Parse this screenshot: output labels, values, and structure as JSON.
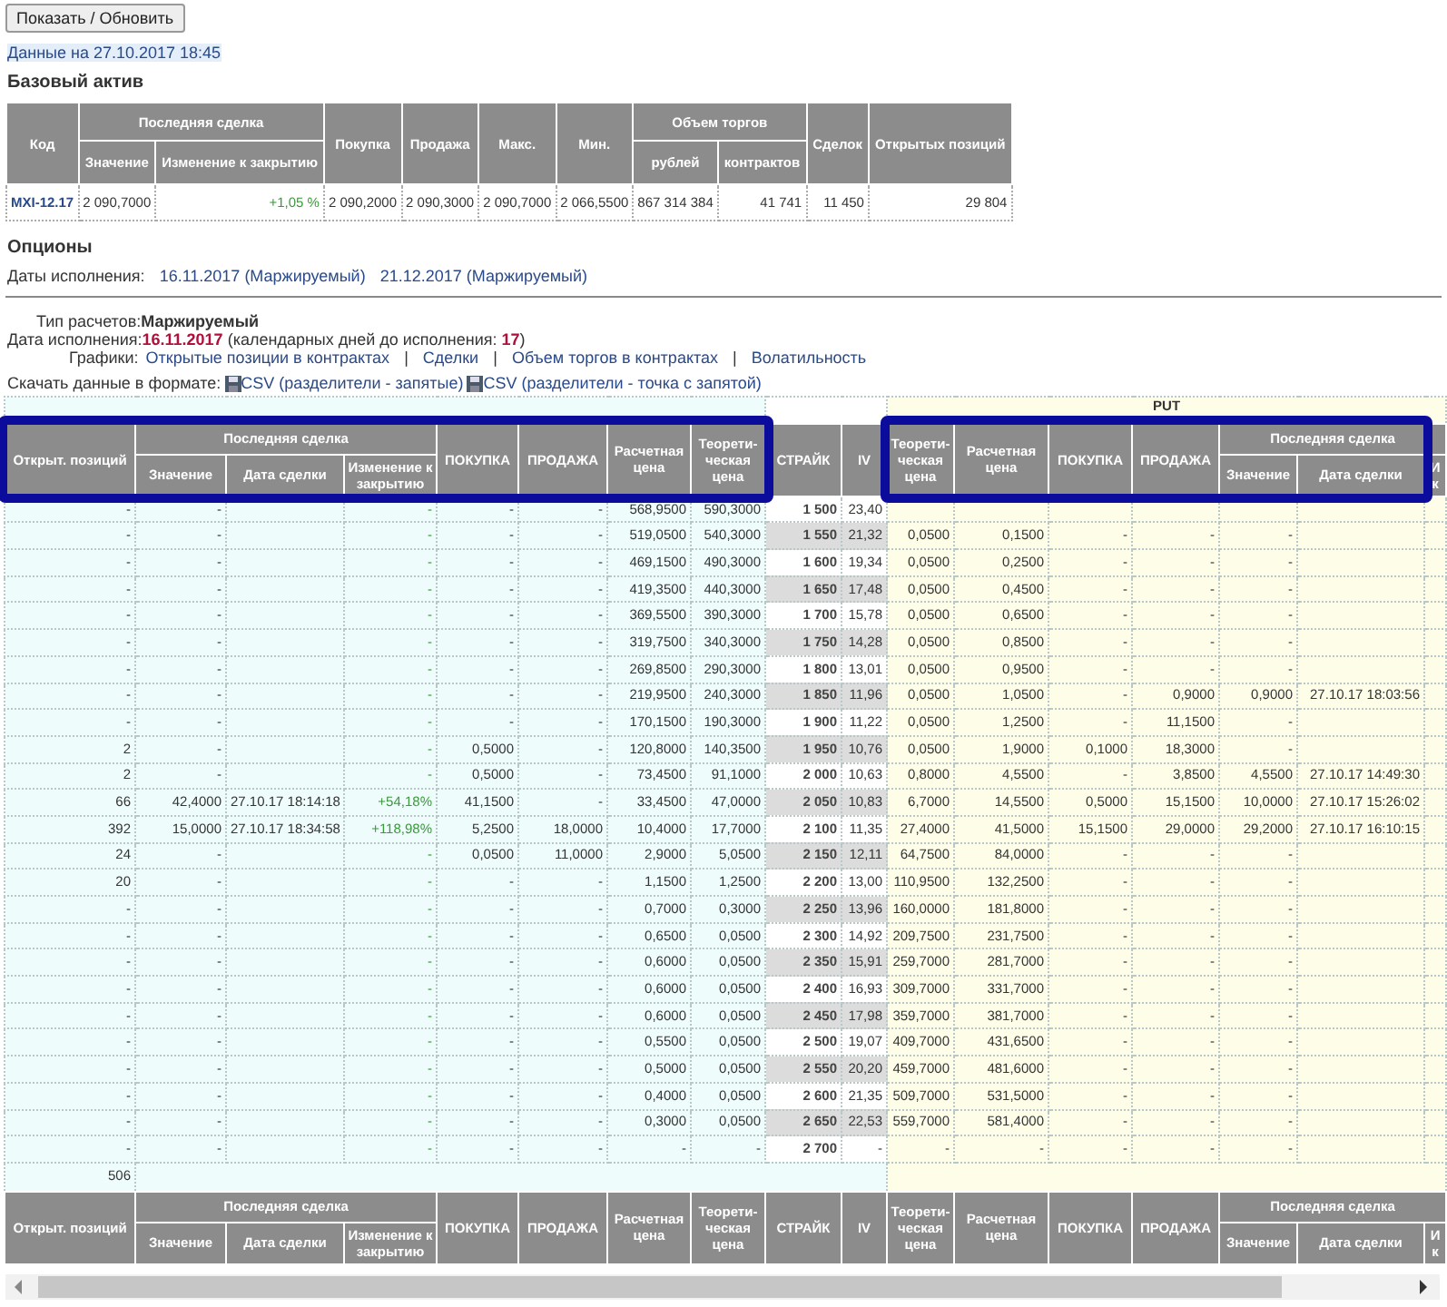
{
  "refresh_button": "Показать / Обновить",
  "data_time": "Данные на 27.10.2017 18:45",
  "underlying": {
    "title": "Базовый актив",
    "header": [
      {
        "label": "Код"
      },
      {
        "group": "Последняя сделка",
        "columns": [
          "Значение",
          "Изменение к закрытию"
        ]
      },
      {
        "label": "Покупка"
      },
      {
        "label": "Продажа"
      },
      {
        "label": "Макс."
      },
      {
        "label": "Мин."
      },
      {
        "group": "Объем торгов",
        "columns": [
          "рублей",
          "контрактов"
        ]
      },
      {
        "label": "Сделок"
      },
      {
        "label": "Открытых позиций"
      }
    ],
    "row": {
      "code": "MXI-12.17",
      "cells": [
        "2 090,7000",
        "+1,05 %",
        "2 090,2000",
        "2 090,3000",
        "2 090,7000",
        "2 066,5500",
        "867 314 384",
        "41 741",
        "11 450",
        "29 804"
      ]
    }
  },
  "options": {
    "title": "Опционы",
    "dates_label": "Даты исполнения:",
    "dates": [
      "16.11.2017 (Маржируемый)",
      "21.12.2017 (Маржируемый)"
    ]
  },
  "settlement": "Тип расчетов:**Маржируемый**",
  "expiry": {
    "label": "Дата исполнения:",
    "date": "16.11.2017",
    "note": "(календарных дней до исполнения:",
    "days": "17",
    "close": ")"
  },
  "charts": {
    "label": "Графики:",
    "links": [
      "Открытые позиции в контрактах",
      "Сделки",
      "Объем торгов в контрактах",
      "Волатильность"
    ],
    "separator": "|"
  },
  "download": {
    "label": "Скачать данные в формате:",
    "links": [
      "CSV (разделители - запятые)",
      "CSV (разделители - точка с запятой)"
    ]
  },
  "put_label": "PUT",
  "header": {
    "highlighted_sides": {
      "call": true,
      "put": true
    },
    "call": [
      {
        "label": "Открыт. позиций"
      },
      {
        "group": "Последняя сделка",
        "columns": [
          "Значение",
          "Дата сделки",
          "Изменение к закрытию"
        ]
      },
      {
        "label": "ПОКУПКА"
      },
      {
        "label": "ПРОДАЖА"
      },
      {
        "label": "Расчетная цена"
      },
      {
        "label": "Теорети-ческая цена"
      }
    ],
    "middle": [
      {
        "label": "СТРАЙК"
      },
      {
        "label": "IV"
      }
    ],
    "put": [
      {
        "label": "Теорети-ческая цена"
      },
      {
        "label": "Расчетная цена"
      },
      {
        "label": "ПОКУПКА"
      },
      {
        "label": "ПРОДАЖА"
      },
      {
        "group": "Последняя сделка",
        "columns": [
          "Значение",
          "Дата сделки",
          "И к"
        ]
      }
    ]
  },
  "rows": [
    {
      "call": {
        "oi": "-",
        "value": "-",
        "change": "-",
        "buy": "-",
        "sell": "-",
        "calc": "568,9500",
        "theor": "590,3000"
      },
      "strike": "1 500",
      "iv": "23,40"
    },
    {
      "call": {
        "oi": "-",
        "value": "-",
        "change": "-",
        "buy": "-",
        "sell": "-",
        "calc": "519,0500",
        "theor": "540,3000"
      },
      "strike": "1 550",
      "iv": "21,32",
      "put": {
        "theor": "0,0500",
        "calc": "0,1500",
        "buy": "-",
        "sell": "-",
        "value": "-"
      }
    },
    {
      "call": {
        "oi": "-",
        "value": "-",
        "change": "-",
        "buy": "-",
        "sell": "-",
        "calc": "469,1500",
        "theor": "490,3000"
      },
      "strike": "1 600",
      "iv": "19,34",
      "put": {
        "theor": "0,0500",
        "calc": "0,2500",
        "buy": "-",
        "sell": "-",
        "value": "-"
      }
    },
    {
      "call": {
        "oi": "-",
        "value": "-",
        "change": "-",
        "buy": "-",
        "sell": "-",
        "calc": "419,3500",
        "theor": "440,3000"
      },
      "strike": "1 650",
      "iv": "17,48",
      "put": {
        "theor": "0,0500",
        "calc": "0,4500",
        "buy": "-",
        "sell": "-",
        "value": "-"
      }
    },
    {
      "call": {
        "oi": "-",
        "value": "-",
        "change": "-",
        "buy": "-",
        "sell": "-",
        "calc": "369,5500",
        "theor": "390,3000"
      },
      "strike": "1 700",
      "iv": "15,78",
      "put": {
        "theor": "0,0500",
        "calc": "0,6500",
        "buy": "-",
        "sell": "-",
        "value": "-"
      }
    },
    {
      "call": {
        "oi": "-",
        "value": "-",
        "change": "-",
        "buy": "-",
        "sell": "-",
        "calc": "319,7500",
        "theor": "340,3000"
      },
      "strike": "1 750",
      "iv": "14,28",
      "put": {
        "theor": "0,0500",
        "calc": "0,8500",
        "buy": "-",
        "sell": "-",
        "value": "-"
      }
    },
    {
      "call": {
        "oi": "-",
        "value": "-",
        "change": "-",
        "buy": "-",
        "sell": "-",
        "calc": "269,8500",
        "theor": "290,3000"
      },
      "strike": "1 800",
      "iv": "13,01",
      "put": {
        "theor": "0,0500",
        "calc": "0,9500",
        "buy": "-",
        "sell": "-",
        "value": "-"
      }
    },
    {
      "call": {
        "oi": "-",
        "value": "-",
        "change": "-",
        "buy": "-",
        "sell": "-",
        "calc": "219,9500",
        "theor": "240,3000"
      },
      "strike": "1 850",
      "iv": "11,96",
      "put": {
        "theor": "0,0500",
        "calc": "1,0500",
        "buy": "-",
        "sell": "0,9000",
        "value": "0,9000",
        "date": "27.10.17 18:03:56"
      }
    },
    {
      "call": {
        "oi": "-",
        "value": "-",
        "change": "-",
        "buy": "-",
        "sell": "-",
        "calc": "170,1500",
        "theor": "190,3000"
      },
      "strike": "1 900",
      "iv": "11,22",
      "put": {
        "theor": "0,0500",
        "calc": "1,2500",
        "buy": "-",
        "sell": "11,1500",
        "value": "-"
      }
    },
    {
      "call": {
        "oi": "2",
        "value": "-",
        "change": "-",
        "buy": "0,5000",
        "sell": "-",
        "calc": "120,8000",
        "theor": "140,3500"
      },
      "strike": "1 950",
      "iv": "10,76",
      "put": {
        "theor": "0,0500",
        "calc": "1,9000",
        "buy": "0,1000",
        "sell": "18,3000",
        "value": "-"
      }
    },
    {
      "call": {
        "oi": "2",
        "value": "-",
        "change": "-",
        "buy": "0,5000",
        "sell": "-",
        "calc": "73,4500",
        "theor": "91,1000"
      },
      "strike": "2 000",
      "iv": "10,63",
      "put": {
        "theor": "0,8000",
        "calc": "4,5500",
        "buy": "-",
        "sell": "3,8500",
        "value": "4,5500",
        "date": "27.10.17 14:49:30"
      }
    },
    {
      "call": {
        "oi": "66",
        "value": "42,4000",
        "date": "27.10.17 18:14:18",
        "change": "+54,18%",
        "buy": "41,1500",
        "sell": "-",
        "calc": "33,4500",
        "theor": "47,0000"
      },
      "strike": "2 050",
      "iv": "10,83",
      "put": {
        "theor": "6,7000",
        "calc": "14,5500",
        "buy": "0,5000",
        "sell": "15,1500",
        "value": "10,0000",
        "date": "27.10.17 15:26:02"
      }
    },
    {
      "call": {
        "oi": "392",
        "value": "15,0000",
        "date": "27.10.17 18:34:58",
        "change": "+118,98%",
        "buy": "5,2500",
        "sell": "18,0000",
        "calc": "10,4000",
        "theor": "17,7000"
      },
      "strike": "2 100",
      "iv": "11,35",
      "put": {
        "theor": "27,4000",
        "calc": "41,5000",
        "buy": "15,1500",
        "sell": "29,0000",
        "value": "29,2000",
        "date": "27.10.17 16:10:15"
      }
    },
    {
      "call": {
        "oi": "24",
        "value": "-",
        "change": "-",
        "buy": "0,0500",
        "sell": "11,0000",
        "calc": "2,9000",
        "theor": "5,0500"
      },
      "strike": "2 150",
      "iv": "12,11",
      "put": {
        "theor": "64,7500",
        "calc": "84,0000",
        "buy": "-",
        "sell": "-",
        "value": "-"
      }
    },
    {
      "call": {
        "oi": "20",
        "value": "-",
        "change": "-",
        "buy": "-",
        "sell": "-",
        "calc": "1,1500",
        "theor": "1,2500"
      },
      "strike": "2 200",
      "iv": "13,00",
      "put": {
        "theor": "110,9500",
        "calc": "132,2500",
        "buy": "-",
        "sell": "-",
        "value": "-"
      }
    },
    {
      "call": {
        "oi": "-",
        "value": "-",
        "change": "-",
        "buy": "-",
        "sell": "-",
        "calc": "0,7000",
        "theor": "0,3000"
      },
      "strike": "2 250",
      "iv": "13,96",
      "put": {
        "theor": "160,0000",
        "calc": "181,8000",
        "buy": "-",
        "sell": "-",
        "value": "-"
      }
    },
    {
      "call": {
        "oi": "-",
        "value": "-",
        "change": "-",
        "buy": "-",
        "sell": "-",
        "calc": "0,6500",
        "theor": "0,0500"
      },
      "strike": "2 300",
      "iv": "14,92",
      "put": {
        "theor": "209,7500",
        "calc": "231,7500",
        "buy": "-",
        "sell": "-",
        "value": "-"
      }
    },
    {
      "call": {
        "oi": "-",
        "value": "-",
        "change": "-",
        "buy": "-",
        "sell": "-",
        "calc": "0,6000",
        "theor": "0,0500"
      },
      "strike": "2 350",
      "iv": "15,91",
      "put": {
        "theor": "259,7000",
        "calc": "281,7000",
        "buy": "-",
        "sell": "-",
        "value": "-"
      }
    },
    {
      "call": {
        "oi": "-",
        "value": "-",
        "change": "-",
        "buy": "-",
        "sell": "-",
        "calc": "0,6000",
        "theor": "0,0500"
      },
      "strike": "2 400",
      "iv": "16,93",
      "put": {
        "theor": "309,7000",
        "calc": "331,7000",
        "buy": "-",
        "sell": "-",
        "value": "-"
      }
    },
    {
      "call": {
        "oi": "-",
        "value": "-",
        "change": "-",
        "buy": "-",
        "sell": "-",
        "calc": "0,6000",
        "theor": "0,0500"
      },
      "strike": "2 450",
      "iv": "17,98",
      "put": {
        "theor": "359,7000",
        "calc": "381,7000",
        "buy": "-",
        "sell": "-",
        "value": "-"
      }
    },
    {
      "call": {
        "oi": "-",
        "value": "-",
        "change": "-",
        "buy": "-",
        "sell": "-",
        "calc": "0,5500",
        "theor": "0,0500"
      },
      "strike": "2 500",
      "iv": "19,07",
      "put": {
        "theor": "409,7000",
        "calc": "431,6500",
        "buy": "-",
        "sell": "-",
        "value": "-"
      }
    },
    {
      "call": {
        "oi": "-",
        "value": "-",
        "change": "-",
        "buy": "-",
        "sell": "-",
        "calc": "0,5000",
        "theor": "0,0500"
      },
      "strike": "2 550",
      "iv": "20,20",
      "put": {
        "theor": "459,7000",
        "calc": "481,6000",
        "buy": "-",
        "sell": "-",
        "value": "-"
      }
    },
    {
      "call": {
        "oi": "-",
        "value": "-",
        "change": "-",
        "buy": "-",
        "sell": "-",
        "calc": "0,4000",
        "theor": "0,0500"
      },
      "strike": "2 600",
      "iv": "21,35",
      "put": {
        "theor": "509,7000",
        "calc": "531,5000",
        "buy": "-",
        "sell": "-",
        "value": "-"
      }
    },
    {
      "call": {
        "oi": "-",
        "value": "-",
        "change": "-",
        "buy": "-",
        "sell": "-",
        "calc": "0,3000",
        "theor": "0,0500"
      },
      "strike": "2 650",
      "iv": "22,53",
      "put": {
        "theor": "559,7000",
        "calc": "581,4000",
        "buy": "-",
        "sell": "-",
        "value": "-"
      }
    },
    {
      "call": {
        "oi": "-",
        "value": "-",
        "change": "-",
        "buy": "-",
        "sell": "-",
        "calc": "-",
        "theor": "-"
      },
      "strike": "2 700",
      "iv": "-",
      "put": {
        "theor": "-",
        "calc": "-",
        "buy": "-",
        "sell": "-",
        "value": "-"
      }
    }
  ],
  "total": {
    "open_positions": "506"
  },
  "footer_header": {
    "call": [
      {
        "label": "Открыт. позиций"
      },
      {
        "group": "Последняя сделка",
        "columns": [
          "Значение",
          "Дата сделки",
          "Изменение к закрытию"
        ]
      },
      {
        "label": "ПОКУПКА"
      },
      {
        "label": "ПРОДАЖА"
      },
      {
        "label": "Расчетная цена"
      },
      {
        "label": "Теорети-ческая цена"
      }
    ],
    "middle": [
      {
        "label": "СТРАЙК"
      },
      {
        "label": "IV"
      }
    ],
    "put": [
      {
        "label": "Теорети-ческая цена"
      },
      {
        "label": "Расчетная цена"
      },
      {
        "label": "ПОКУПКА"
      },
      {
        "label": "ПРОДАЖА"
      },
      {
        "group": "Последняя сделка",
        "columns": [
          "Значение",
          "Дата сделки",
          "И к"
        ]
      }
    ]
  }
}
